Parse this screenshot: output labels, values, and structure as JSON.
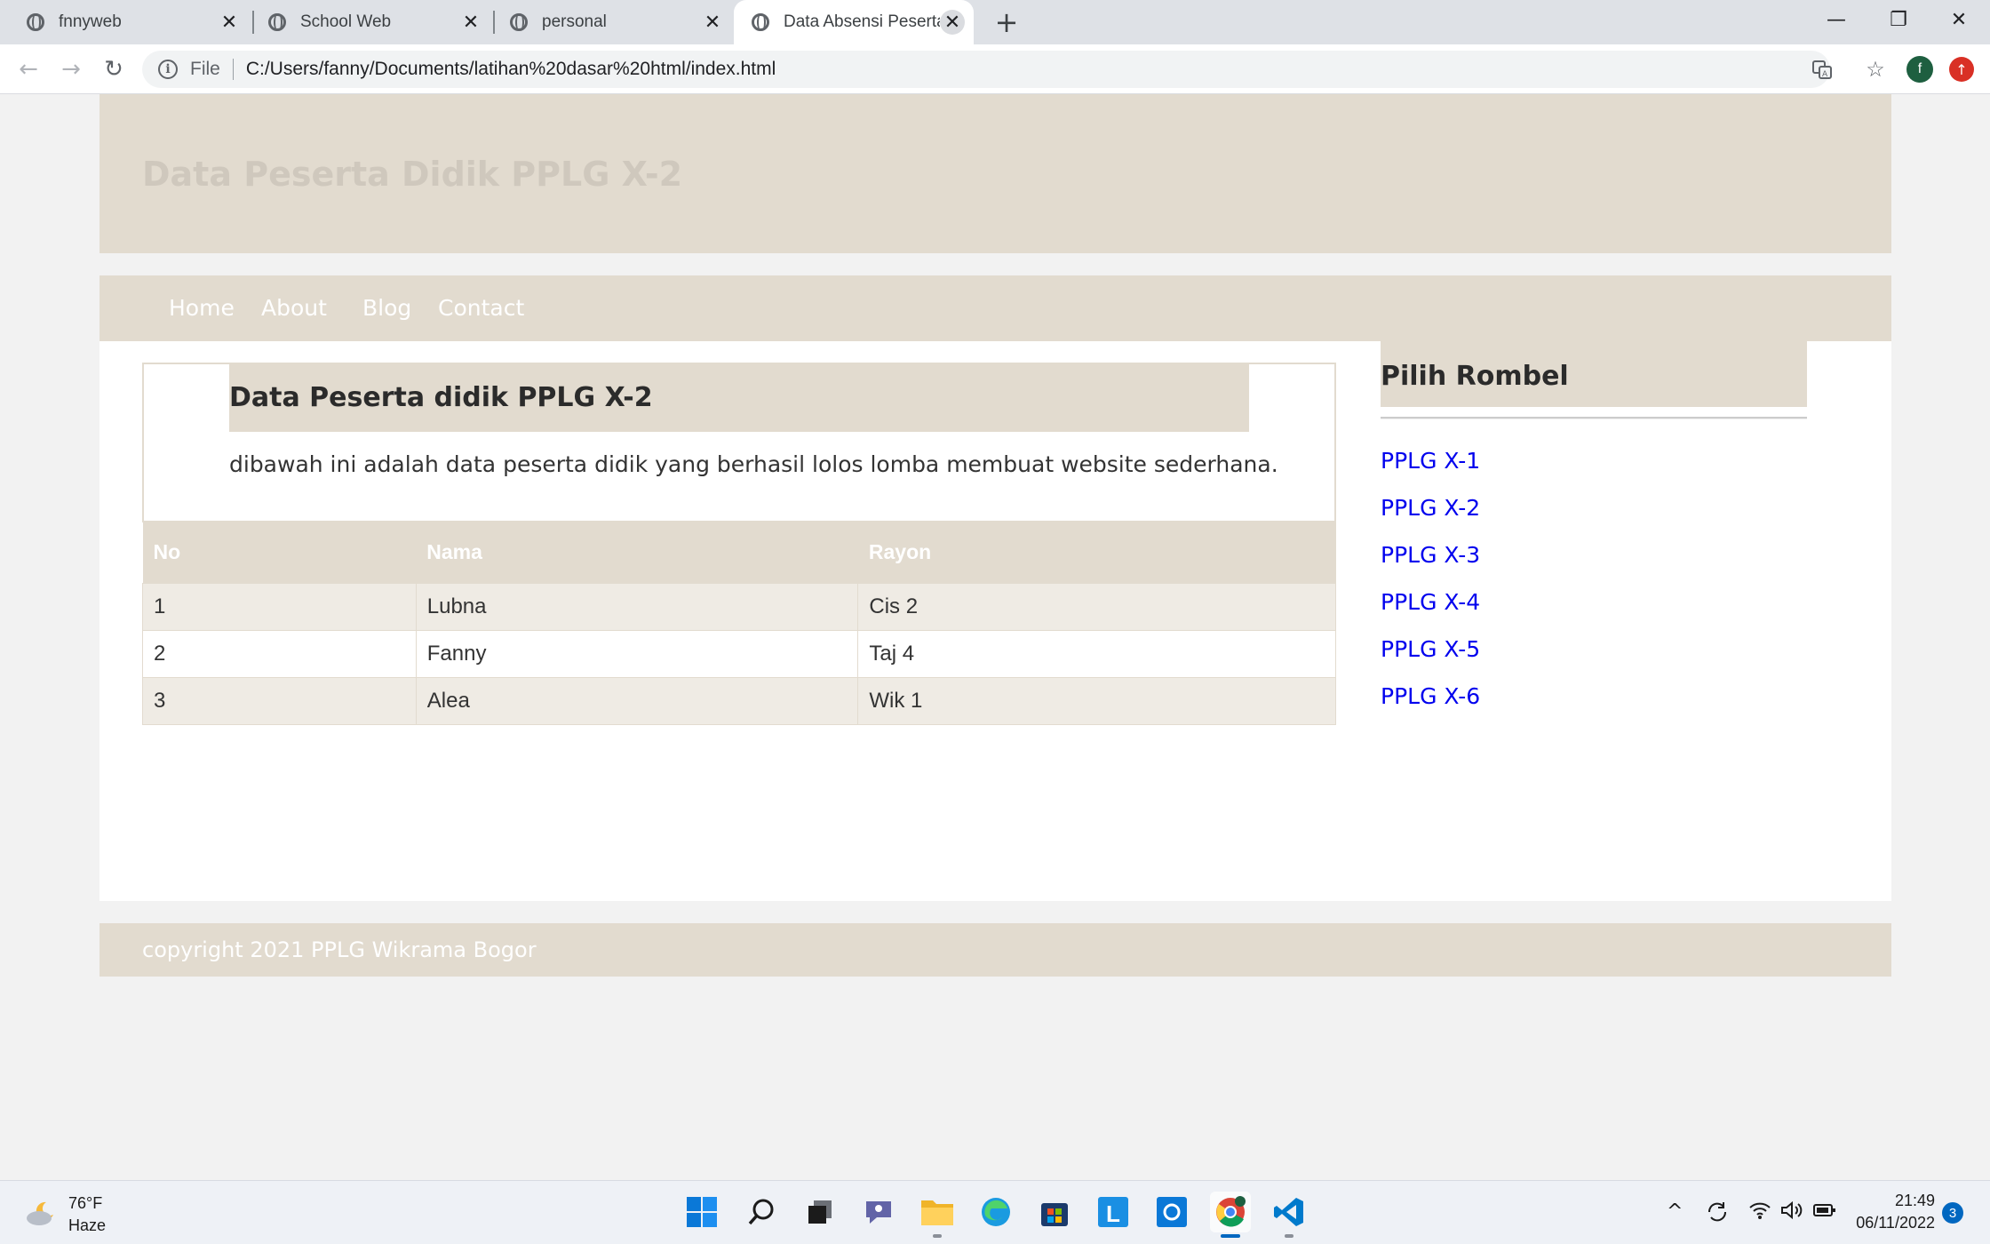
{
  "browser": {
    "tabs": [
      {
        "title": "fnnyweb",
        "close": "✕"
      },
      {
        "title": "School Web",
        "close": "✕"
      },
      {
        "title": "personal",
        "close": "✕"
      },
      {
        "title": "Data Absensi Peserta",
        "close": "✕"
      }
    ],
    "new_tab": "+",
    "window_controls": {
      "minimize": "—",
      "maximize": "❐",
      "close": "✕"
    },
    "nav": {
      "back": "←",
      "forward": "→",
      "reload": "↻"
    },
    "address": {
      "info": "i",
      "scheme": "File",
      "url": "C:/Users/fanny/Documents/latihan%20dasar%20html/index.html"
    },
    "profile_initial": "f",
    "update_icon": "↑"
  },
  "page": {
    "header_title": "Data Peserta Didik PPLG X-2",
    "menu": [
      "Home",
      "About",
      "Blog",
      "Contact"
    ],
    "article": {
      "title": "Data Peserta didik PPLG X-2",
      "description": "dibawah ini adalah data peserta didik yang berhasil lolos lomba membuat website sederhana."
    },
    "table": {
      "headers": [
        "No",
        "Nama",
        "Rayon"
      ],
      "rows": [
        [
          "1",
          "Lubna",
          "Cis 2"
        ],
        [
          "2",
          "Fanny",
          "Taj 4"
        ],
        [
          "3",
          "Alea",
          "Wik 1"
        ]
      ]
    },
    "aside": {
      "title": "Pilih Rombel",
      "links": [
        "PPLG X-1",
        "PPLG X-2",
        "PPLG X-3",
        "PPLG X-4",
        "PPLG X-5",
        "PPLG X-6"
      ]
    },
    "footer": "copyright 2021 PPLG Wikrama Bogor"
  },
  "taskbar": {
    "weather": {
      "temp": "76°F",
      "condition": "Haze"
    },
    "time": "21:49",
    "date": "06/11/2022",
    "notifications": "3",
    "tray": {
      "chevron": "^",
      "wifi": "◠",
      "volume": "🔈︎",
      "battery": "▭"
    }
  },
  "colors": {
    "accent_beige": "#e2dbcf",
    "row_stripe": "#efebe4",
    "link_blue": "#0000ee"
  }
}
